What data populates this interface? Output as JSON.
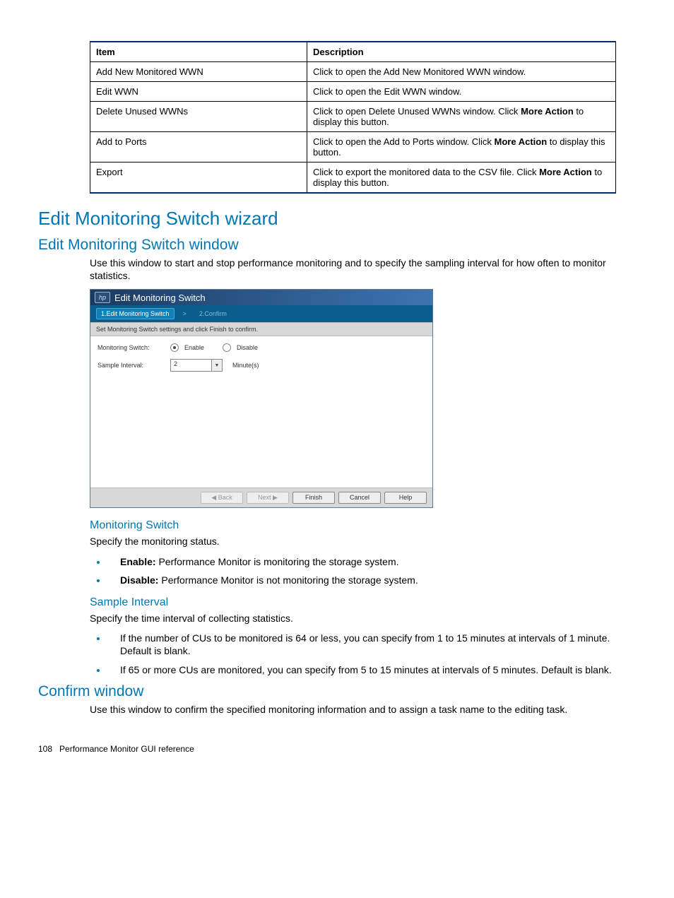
{
  "table": {
    "headers": [
      "Item",
      "Description"
    ],
    "rows": [
      {
        "item": "Add New Monitored WWN",
        "desc_pre": "Click to open the Add New Monitored WWN window.",
        "bold": "",
        "desc_post": ""
      },
      {
        "item": "Edit WWN",
        "desc_pre": "Click to open the Edit WWN window.",
        "bold": "",
        "desc_post": ""
      },
      {
        "item": "Delete Unused WWNs",
        "desc_pre": "Click to open Delete Unused WWNs window. Click ",
        "bold": "More Action",
        "desc_post": " to display this button."
      },
      {
        "item": "Add to Ports",
        "desc_pre": "Click to open the Add to Ports window. Click ",
        "bold": "More Action",
        "desc_post": " to display this button."
      },
      {
        "item": "Export",
        "desc_pre": "Click to export the monitored data to the CSV file. Click ",
        "bold": "More Action",
        "desc_post": " to display this button."
      }
    ]
  },
  "headings": {
    "h1": "Edit Monitoring Switch wizard",
    "h2a": "Edit Monitoring Switch window",
    "h2a_body": "Use this window to start and stop performance monitoring and to specify the sampling interval for how often to monitor statistics.",
    "h4a": "Monitoring Switch",
    "h4a_body": "Specify the monitoring status.",
    "h4b": "Sample Interval",
    "h4b_body": "Specify the time interval of collecting statistics.",
    "h2b": "Confirm window",
    "h2b_body": "Use this window to confirm the specified monitoring information and to assign a task name to the editing task."
  },
  "list_ms": {
    "item1_bold": "Enable:",
    "item1_text": " Performance Monitor is monitoring the storage system.",
    "item2_bold": "Disable:",
    "item2_text": " Performance Monitor is not monitoring the storage system."
  },
  "list_si": {
    "item1": "If the number of CUs to be monitored is 64 or less, you can specify from 1 to 15 minutes at intervals of 1 minute. Default is blank.",
    "item2": "If 65 or more CUs are monitored, you can specify from 5 to 15 minutes at intervals of 5 minutes. Default is blank."
  },
  "wizard": {
    "logo": "hp",
    "title": "Edit Monitoring Switch",
    "step1": "1.Edit Monitoring Switch",
    "step_sep": ">",
    "step2": "2.Confirm",
    "instruction": "Set Monitoring Switch settings and click Finish to confirm.",
    "label_ms": "Monitoring Switch:",
    "opt_enable": "Enable",
    "opt_disable": "Disable",
    "label_si": "Sample Interval:",
    "si_value": "2",
    "si_unit": "Minute(s)",
    "buttons": {
      "back": "◀ Back",
      "next": "Next ▶",
      "finish": "Finish",
      "cancel": "Cancel",
      "help": "Help"
    }
  },
  "footer": {
    "pagenum": "108",
    "section": "Performance Monitor GUI reference"
  }
}
